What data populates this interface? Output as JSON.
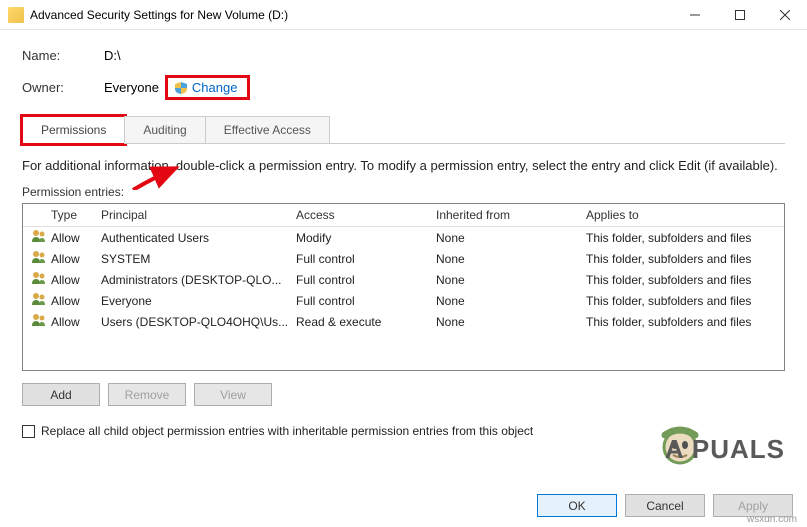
{
  "window": {
    "title": "Advanced Security Settings for New Volume (D:)"
  },
  "fields": {
    "name_label": "Name:",
    "name_value": "D:\\",
    "owner_label": "Owner:",
    "owner_value": "Everyone",
    "change_label": "Change"
  },
  "tabs": [
    {
      "label": "Permissions",
      "active": true,
      "highlighted": true
    },
    {
      "label": "Auditing",
      "active": false,
      "highlighted": false
    },
    {
      "label": "Effective Access",
      "active": false,
      "highlighted": false
    }
  ],
  "info_text": "For additional information, double-click a permission entry. To modify a permission entry, select the entry and click Edit (if available).",
  "entries_label": "Permission entries:",
  "columns": {
    "type": "Type",
    "principal": "Principal",
    "access": "Access",
    "inherited": "Inherited from",
    "applies": "Applies to"
  },
  "entries": [
    {
      "type": "Allow",
      "principal": "Authenticated Users",
      "access": "Modify",
      "inherited": "None",
      "applies": "This folder, subfolders and files"
    },
    {
      "type": "Allow",
      "principal": "SYSTEM",
      "access": "Full control",
      "inherited": "None",
      "applies": "This folder, subfolders and files"
    },
    {
      "type": "Allow",
      "principal": "Administrators (DESKTOP-QLO...",
      "access": "Full control",
      "inherited": "None",
      "applies": "This folder, subfolders and files"
    },
    {
      "type": "Allow",
      "principal": "Everyone",
      "access": "Full control",
      "inherited": "None",
      "applies": "This folder, subfolders and files"
    },
    {
      "type": "Allow",
      "principal": "Users (DESKTOP-QLO4OHQ\\Us...",
      "access": "Read & execute",
      "inherited": "None",
      "applies": "This folder, subfolders and files"
    }
  ],
  "buttons": {
    "add": "Add",
    "remove": "Remove",
    "view": "View",
    "ok": "OK",
    "cancel": "Cancel",
    "apply": "Apply"
  },
  "checkbox_label": "Replace all child object permission entries with inheritable permission entries from this object",
  "watermark": "A   PUALS",
  "site": "wsxdn.com"
}
